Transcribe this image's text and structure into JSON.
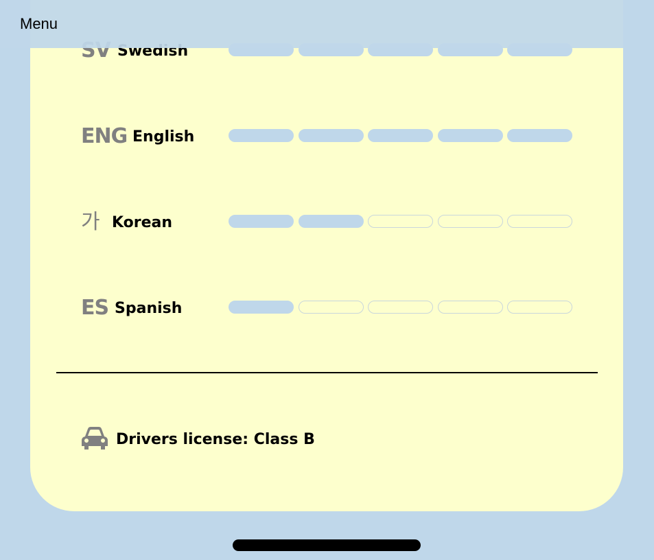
{
  "menu": {
    "label": "Menu"
  },
  "languages": [
    {
      "code": "SV",
      "name": "Swedish",
      "level": 5,
      "max": 5
    },
    {
      "code": "ENG",
      "name": "English",
      "level": 5,
      "max": 5
    },
    {
      "code": "가",
      "name": "Korean",
      "level": 2,
      "max": 5
    },
    {
      "code": "ES",
      "name": "Spanish",
      "level": 1,
      "max": 5
    }
  ],
  "license": {
    "icon": "car-icon",
    "text": "Drivers license: Class B"
  },
  "colors": {
    "background": "#bfd7ea",
    "card": "#fdffcd",
    "bar_filled": "#bfd7ea",
    "bar_empty_border": "#c9d6dc",
    "code_text": "#808080"
  }
}
